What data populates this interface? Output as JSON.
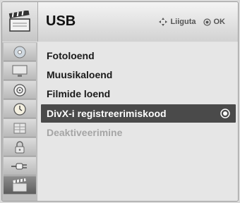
{
  "header": {
    "title": "USB",
    "hint_move": "Liiguta",
    "hint_ok": "OK",
    "icon": "clapperboard-icon"
  },
  "sidebar": {
    "items": [
      {
        "icon": "disc-icon"
      },
      {
        "icon": "monitor-icon"
      },
      {
        "icon": "speaker-icon"
      },
      {
        "icon": "clock-icon"
      },
      {
        "icon": "grid-icon"
      },
      {
        "icon": "lock-icon"
      },
      {
        "icon": "plug-icon"
      },
      {
        "icon": "clapperboard-icon",
        "active": true
      }
    ]
  },
  "menu": {
    "items": [
      {
        "label": "Fotoloend"
      },
      {
        "label": "Muusikaloend"
      },
      {
        "label": "Filmide loend"
      },
      {
        "label": "DivX-i registreerimiskood",
        "selected": true
      },
      {
        "label": "Deaktiveerimine",
        "disabled": true
      }
    ]
  },
  "colors": {
    "selected_bg": "#4a4a4a",
    "disabled_text": "#a5a5a5"
  }
}
